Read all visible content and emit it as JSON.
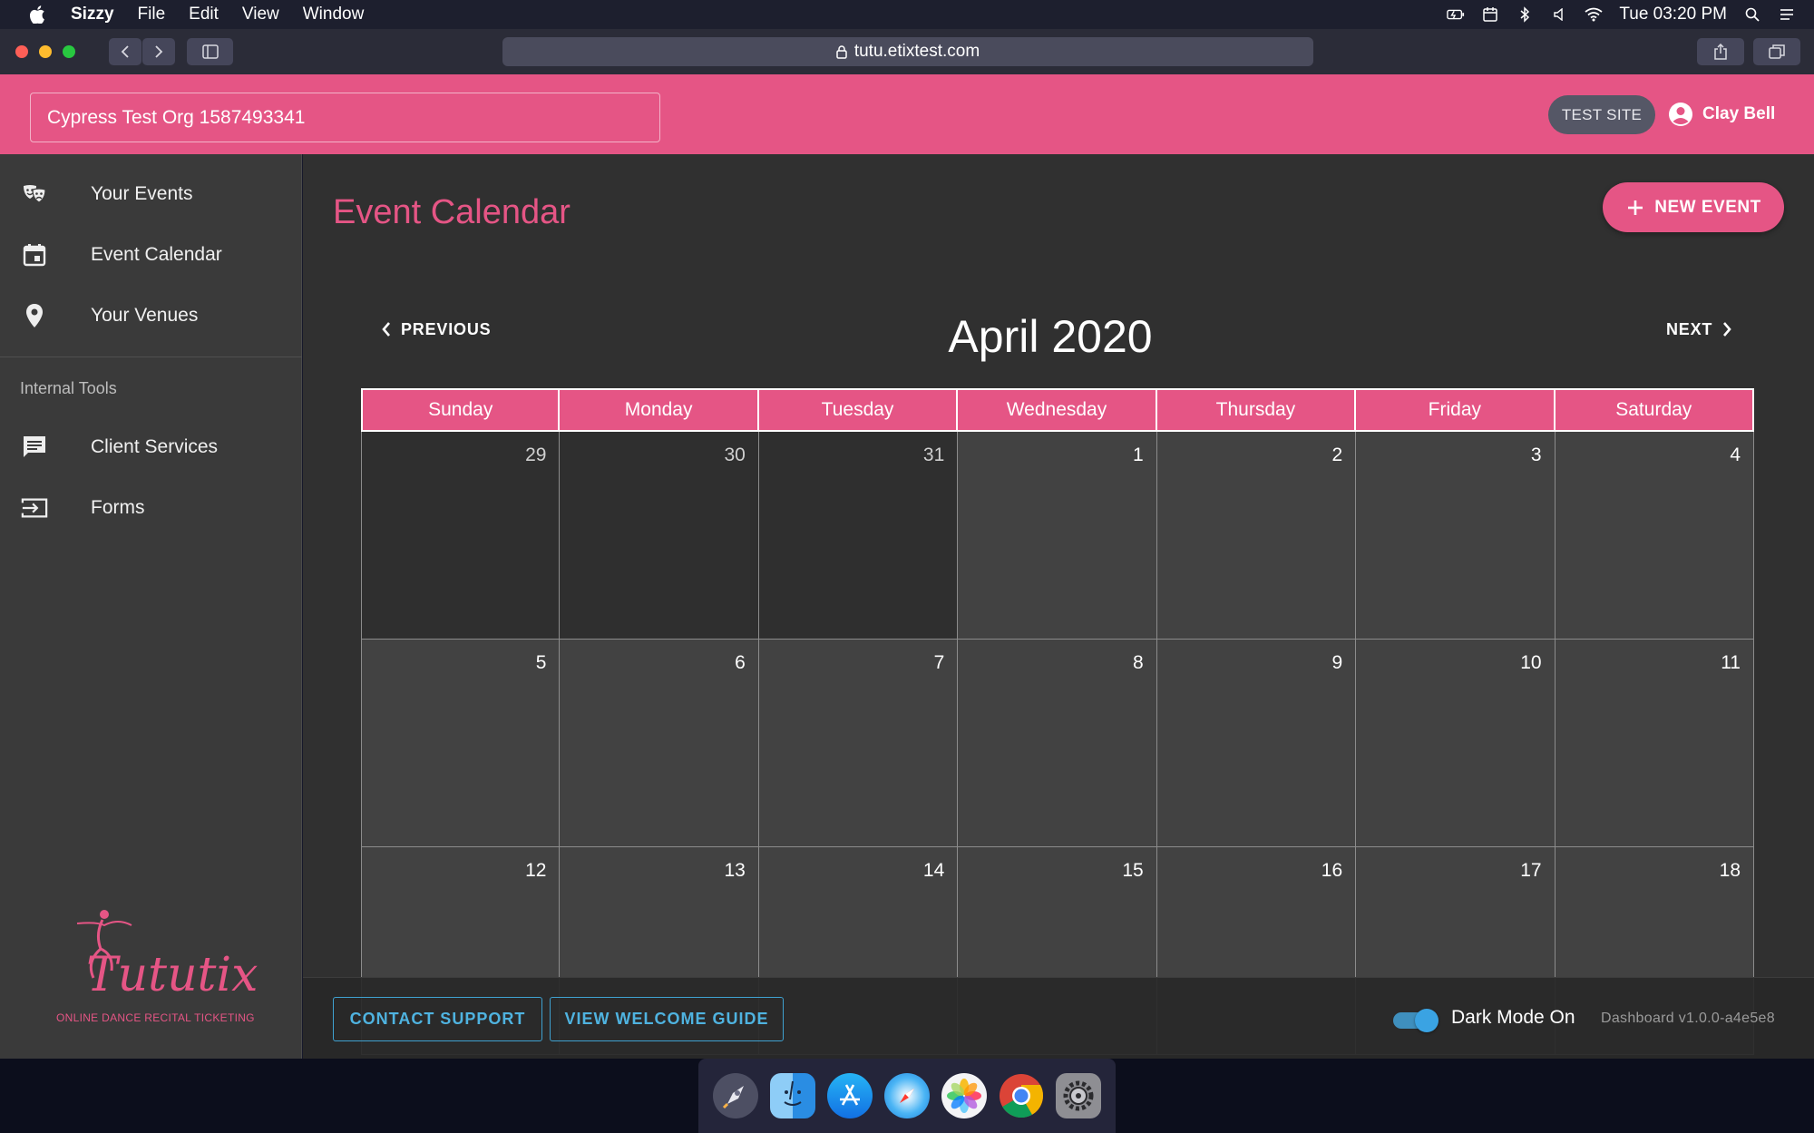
{
  "menubar": {
    "app_name": "Sizzy",
    "menus": [
      "File",
      "Edit",
      "View",
      "Window"
    ],
    "clock": "Tue 03:20 PM"
  },
  "browser": {
    "url": "tutu.etixtest.com"
  },
  "header": {
    "org_name": "Cypress Test Org 1587493341",
    "test_site_label": "TEST SITE",
    "user_name": "Clay Bell"
  },
  "sidebar": {
    "items": [
      {
        "label": "Your Events",
        "icon": "masks-icon"
      },
      {
        "label": "Event Calendar",
        "icon": "calendar-icon"
      },
      {
        "label": "Your Venues",
        "icon": "location-pin-icon"
      }
    ],
    "section_title": "Internal Tools",
    "tool_items": [
      {
        "label": "Client Services",
        "icon": "chat-icon"
      },
      {
        "label": "Forms",
        "icon": "login-icon"
      }
    ],
    "logo": {
      "brand": "Tututix",
      "tagline": "ONLINE DANCE RECITAL TICKETING"
    }
  },
  "main": {
    "title": "Event Calendar",
    "new_event_label": "NEW EVENT",
    "previous_label": "PREVIOUS",
    "next_label": "NEXT",
    "month_title": "April 2020",
    "weekdays": [
      "Sunday",
      "Monday",
      "Tuesday",
      "Wednesday",
      "Thursday",
      "Friday",
      "Saturday"
    ],
    "weeks": [
      [
        "29",
        "30",
        "31",
        "1",
        "2",
        "3",
        "4"
      ],
      [
        "5",
        "6",
        "7",
        "8",
        "9",
        "10",
        "11"
      ],
      [
        "12",
        "13",
        "14",
        "15",
        "16",
        "17",
        "18"
      ]
    ],
    "outside_month_days": [
      "29",
      "30",
      "31"
    ]
  },
  "footer": {
    "contact_support_label": "CONTACT SUPPORT",
    "welcome_guide_label": "VIEW WELCOME GUIDE",
    "dark_mode_label": "Dark Mode On",
    "dark_mode_on": true,
    "version": "Dashboard v1.0.0-a4e5e8"
  },
  "colors": {
    "accent": "#e55585",
    "link_blue": "#4fb3e0",
    "toggle_blue": "#3aa3e3"
  },
  "dock": {
    "apps": [
      "launchpad-icon",
      "finder-icon",
      "app-store-icon",
      "safari-icon",
      "photos-icon",
      "chrome-icon",
      "system-preferences-icon"
    ]
  }
}
